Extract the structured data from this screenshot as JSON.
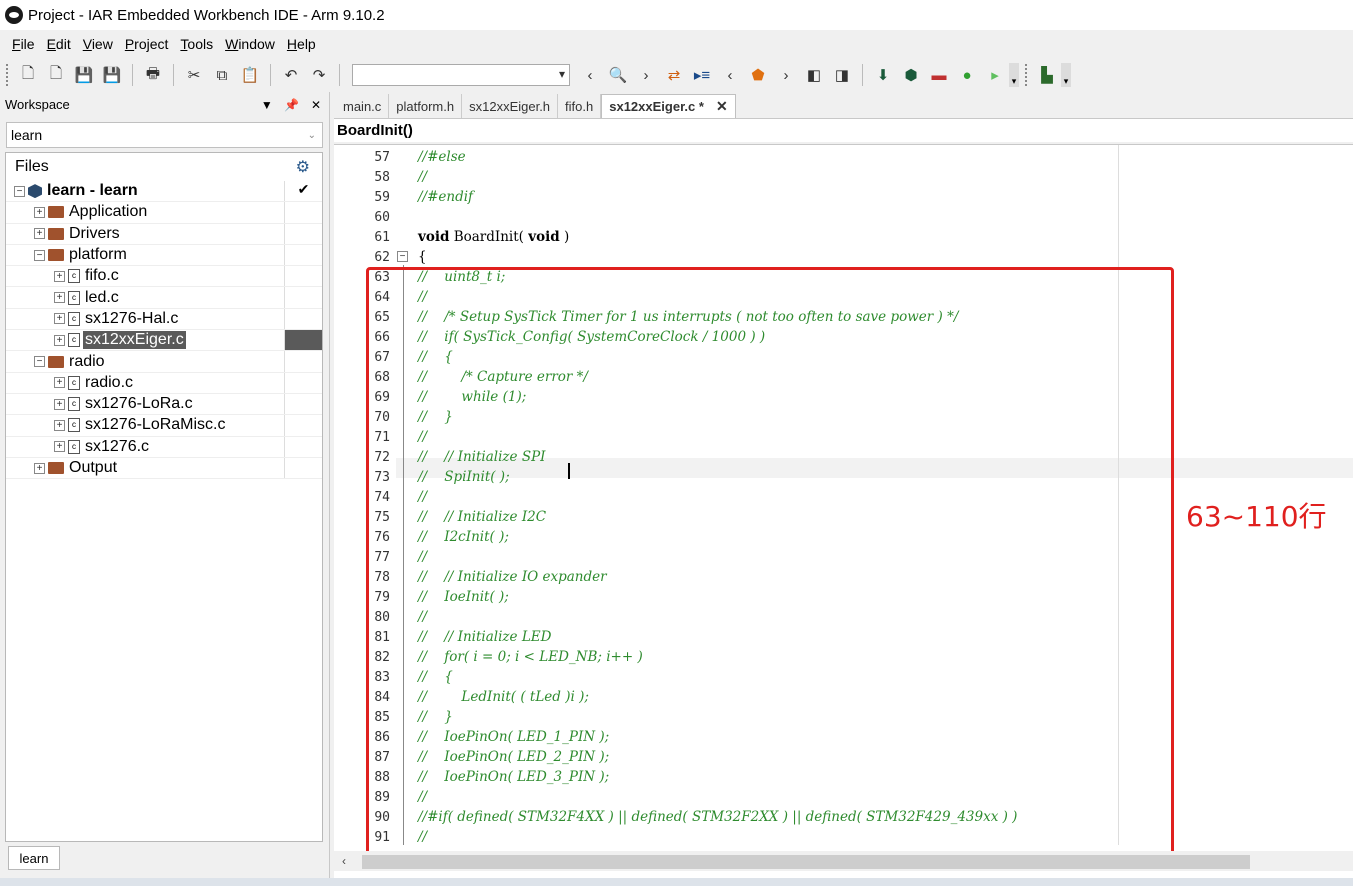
{
  "window": {
    "title": "Project - IAR Embedded Workbench IDE - Arm 9.10.2"
  },
  "menu": [
    {
      "label": "File",
      "key": "F",
      "rest": "ile"
    },
    {
      "label": "Edit",
      "key": "E",
      "rest": "dit"
    },
    {
      "label": "View",
      "key": "V",
      "rest": "iew"
    },
    {
      "label": "Project",
      "key": "P",
      "rest": "roject"
    },
    {
      "label": "Tools",
      "key": "T",
      "rest": "ools"
    },
    {
      "label": "Window",
      "key": "W",
      "rest": "indow"
    },
    {
      "label": "Help",
      "key": "H",
      "rest": "elp"
    }
  ],
  "workspace": {
    "title": "Workspace",
    "config": "learn",
    "files_header": "Files",
    "tab": "learn",
    "tree": [
      {
        "label": "learn - learn",
        "type": "project",
        "level": 0,
        "exp": "−",
        "check": "✔"
      },
      {
        "label": "Application",
        "type": "folder",
        "level": 1,
        "exp": "+"
      },
      {
        "label": "Drivers",
        "type": "folder",
        "level": 1,
        "exp": "+"
      },
      {
        "label": "platform",
        "type": "folder",
        "level": 1,
        "exp": "−"
      },
      {
        "label": "fifo.c",
        "type": "file",
        "level": 2,
        "exp": "+"
      },
      {
        "label": "led.c",
        "type": "file",
        "level": 2,
        "exp": "+"
      },
      {
        "label": "sx1276-Hal.c",
        "type": "file",
        "level": 2,
        "exp": "+"
      },
      {
        "label": "sx12xxEiger.c",
        "type": "file",
        "level": 2,
        "exp": "+",
        "selected": true
      },
      {
        "label": "radio",
        "type": "folder",
        "level": 1,
        "exp": "−"
      },
      {
        "label": "radio.c",
        "type": "file",
        "level": 2,
        "exp": "+"
      },
      {
        "label": "sx1276-LoRa.c",
        "type": "file",
        "level": 2,
        "exp": "+"
      },
      {
        "label": "sx1276-LoRaMisc.c",
        "type": "file",
        "level": 2,
        "exp": "+"
      },
      {
        "label": "sx1276.c",
        "type": "file",
        "level": 2,
        "exp": "+"
      },
      {
        "label": "Output",
        "type": "folder",
        "level": 1,
        "exp": "+"
      }
    ]
  },
  "editor": {
    "tabs": [
      {
        "label": "main.c",
        "active": false
      },
      {
        "label": "platform.h",
        "active": false
      },
      {
        "label": "sx12xxEiger.h",
        "active": false
      },
      {
        "label": "fifo.h",
        "active": false
      },
      {
        "label": "sx12xxEiger.c *",
        "active": true
      }
    ],
    "function": "BoardInit()",
    "annotation": "63~110行",
    "lines": [
      {
        "n": "57",
        "t": "//#else",
        "c": true
      },
      {
        "n": "58",
        "t": "//",
        "c": true
      },
      {
        "n": "59",
        "t": "//#endif",
        "c": true
      },
      {
        "n": "60",
        "t": "",
        "c": false
      },
      {
        "n": "61",
        "t": "void BoardInit( void )",
        "c": false
      },
      {
        "n": "62",
        "t": "{",
        "c": false
      },
      {
        "n": "63",
        "t": "//    uint8_t i;",
        "c": true
      },
      {
        "n": "64",
        "t": "//",
        "c": true
      },
      {
        "n": "65",
        "t": "//    /* Setup SysTick Timer for 1 us interrupts ( not too often to save power ) */",
        "c": true
      },
      {
        "n": "66",
        "t": "//    if( SysTick_Config( SystemCoreClock / 1000 ) )",
        "c": true
      },
      {
        "n": "67",
        "t": "//    {",
        "c": true
      },
      {
        "n": "68",
        "t": "//        /* Capture error */",
        "c": true
      },
      {
        "n": "69",
        "t": "//        while (1);",
        "c": true
      },
      {
        "n": "70",
        "t": "//    }",
        "c": true
      },
      {
        "n": "71",
        "t": "//",
        "c": true
      },
      {
        "n": "72",
        "t": "//    // Initialize SPI",
        "c": true
      },
      {
        "n": "73",
        "t": "//    SpiInit( );",
        "c": true
      },
      {
        "n": "74",
        "t": "//",
        "c": true
      },
      {
        "n": "75",
        "t": "//    // Initialize I2C",
        "c": true
      },
      {
        "n": "76",
        "t": "//    I2cInit( );",
        "c": true
      },
      {
        "n": "77",
        "t": "//",
        "c": true
      },
      {
        "n": "78",
        "t": "//    // Initialize IO expander",
        "c": true
      },
      {
        "n": "79",
        "t": "//    IoeInit( );",
        "c": true
      },
      {
        "n": "80",
        "t": "//",
        "c": true
      },
      {
        "n": "81",
        "t": "//    // Initialize LED",
        "c": true
      },
      {
        "n": "82",
        "t": "//    for( i = 0; i < LED_NB; i++ )",
        "c": true
      },
      {
        "n": "83",
        "t": "//    {",
        "c": true
      },
      {
        "n": "84",
        "t": "//        LedInit( ( tLed )i );",
        "c": true
      },
      {
        "n": "85",
        "t": "//    }",
        "c": true
      },
      {
        "n": "86",
        "t": "//    IoePinOn( LED_1_PIN );",
        "c": true
      },
      {
        "n": "87",
        "t": "//    IoePinOn( LED_2_PIN );",
        "c": true
      },
      {
        "n": "88",
        "t": "//    IoePinOn( LED_3_PIN );",
        "c": true
      },
      {
        "n": "89",
        "t": "//",
        "c": true
      },
      {
        "n": "90",
        "t": "//#if( defined( STM32F4XX ) || defined( STM32F2XX ) || defined( STM32F429_439xx ) )",
        "c": true
      },
      {
        "n": "91",
        "t": "//",
        "c": true
      }
    ]
  }
}
